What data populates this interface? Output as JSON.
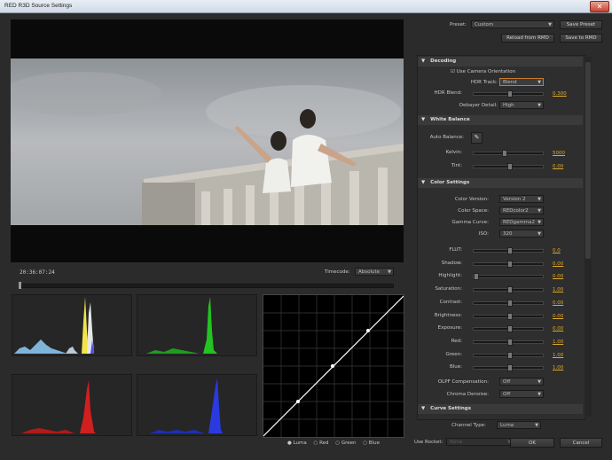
{
  "window": {
    "title": "RED R3D Source Settings"
  },
  "viewer": {
    "timecode": "20:36:07:24",
    "timecode_label": "Timecode:",
    "timecode_mode": "Absolute"
  },
  "curve_legend": {
    "luma": "Luma",
    "red": "Red",
    "green": "Green",
    "blue": "Blue"
  },
  "top": {
    "preset_label": "Preset:",
    "preset_value": "Custom",
    "save_preset": "Save Preset",
    "reload_from_rmd": "Reload from RMD",
    "save_to_rmd": "Save to RMD"
  },
  "decoding": {
    "header": "Decoding",
    "use_camera_orientation": "Use Camera Orientation",
    "hdr_track_label": "HDR Track:",
    "hdr_track_value": "Blend",
    "hdr_blend_label": "HDR Blend:",
    "hdr_blend_value": "0.300",
    "debayer_label": "Debayer Detail:",
    "debayer_value": "High"
  },
  "white_balance": {
    "header": "White Balance",
    "auto_balance_label": "Auto Balance:",
    "kelvin_label": "Kelvin:",
    "kelvin_value": "5000",
    "tint_label": "Tint:",
    "tint_value": "0.00"
  },
  "color_settings": {
    "header": "Color Settings",
    "color_version_label": "Color Version:",
    "color_version_value": "Version 2",
    "color_space_label": "Color Space:",
    "color_space_value": "REDcolor2",
    "gamma_curve_label": "Gamma Curve:",
    "gamma_curve_value": "REDgamma2",
    "iso_label": "ISO:",
    "iso_value": "320",
    "sliders": [
      {
        "label": "FLUT:",
        "value": "0.0"
      },
      {
        "label": "Shadow:",
        "value": "0.00"
      },
      {
        "label": "Highlight:",
        "value": "0.00"
      },
      {
        "label": "Saturation:",
        "value": "1.00"
      },
      {
        "label": "Contrast:",
        "value": "0.00"
      },
      {
        "label": "Brightness:",
        "value": "0.00"
      },
      {
        "label": "Exposure:",
        "value": "0.00"
      },
      {
        "label": "Red:",
        "value": "1.00"
      },
      {
        "label": "Green:",
        "value": "1.00"
      },
      {
        "label": "Blue:",
        "value": "1.00"
      }
    ],
    "olpf_label": "OLPF Compensation:",
    "olpf_value": "Off",
    "chroma_label": "Chroma Denoise:",
    "chroma_value": "Off"
  },
  "curve_settings": {
    "header": "Curve Settings",
    "channel_type_label": "Channel Type:",
    "channel_type_value": "Luma"
  },
  "bottom": {
    "use_rocket_label": "Use Rocket:",
    "use_rocket_value": "None",
    "ok": "OK",
    "cancel": "Cancel"
  },
  "colors": {
    "accent_value": "#e0a92b",
    "panel": "#2b2b2b",
    "header": "#3a3a3a"
  }
}
